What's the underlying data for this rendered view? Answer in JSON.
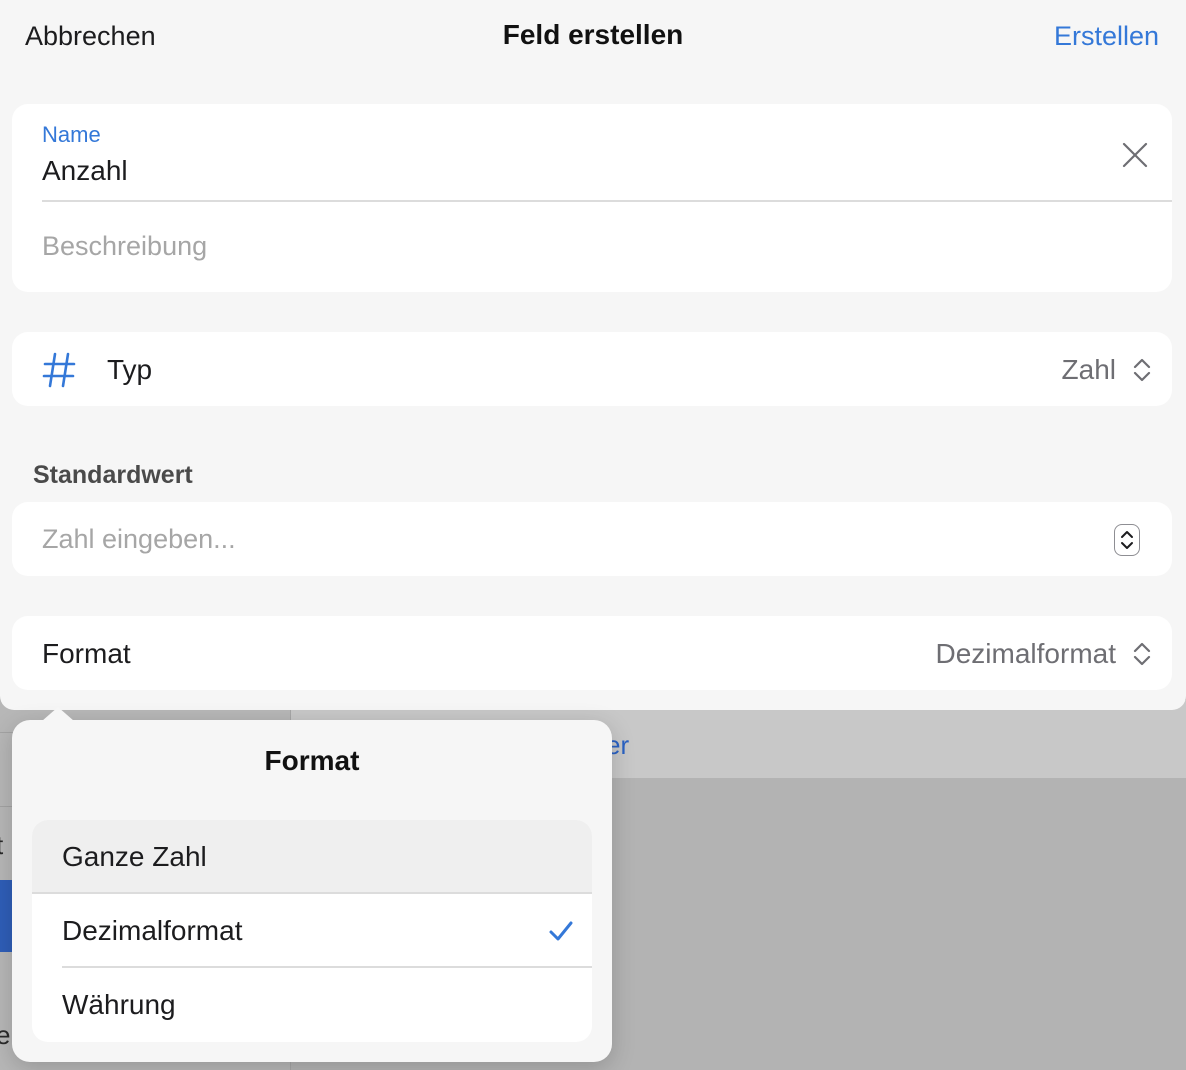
{
  "background": {
    "fragments": [
      "t",
      "e",
      "er"
    ]
  },
  "nav": {
    "cancel_label": "Abbrechen",
    "title": "Feld erstellen",
    "create_label": "Erstellen"
  },
  "name_card": {
    "label": "Name",
    "value": "Anzahl",
    "description_placeholder": "Beschreibung",
    "clear_icon": "close-icon"
  },
  "type_row": {
    "icon": "hash-icon",
    "label": "Typ",
    "value": "Zahl",
    "disclosure_icon": "chevron-up-down-icon"
  },
  "default_section": {
    "header": "Standardwert",
    "placeholder": "Zahl eingeben...",
    "stepper_icon": "stepper-icon"
  },
  "format_row": {
    "label": "Format",
    "value": "Dezimalformat",
    "disclosure_icon": "chevron-up-down-icon"
  },
  "popover": {
    "title": "Format",
    "options": [
      {
        "label": "Ganze Zahl",
        "selected": false,
        "highlighted": true
      },
      {
        "label": "Dezimalformat",
        "selected": true,
        "highlighted": false
      },
      {
        "label": "Währung",
        "selected": false,
        "highlighted": false
      }
    ],
    "check_icon": "checkmark-icon"
  },
  "colors": {
    "accent": "#3478d8",
    "sheet_background": "#f6f6f6",
    "card_background": "#ffffff",
    "dimmed_backdrop": "#b3b3b3",
    "secondary_text": "#6e6e73",
    "placeholder_text": "#a6a6a6"
  }
}
